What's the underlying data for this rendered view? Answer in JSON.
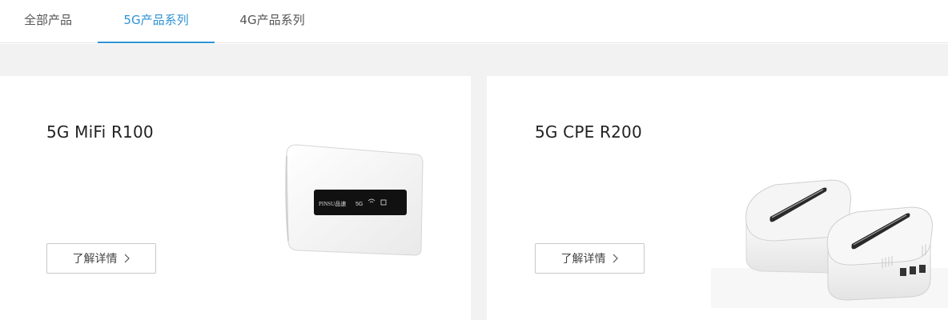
{
  "tabs": [
    {
      "label": "全部产品",
      "active": false
    },
    {
      "label": "5G产品系列",
      "active": true
    },
    {
      "label": "4G产品系列",
      "active": false
    }
  ],
  "accent_color": "#2f93d4",
  "products": [
    {
      "title": "5G MiFi R100",
      "button_label": "了解详情",
      "device_brand_text": "PINSU品速",
      "device_screen_text": "5G",
      "image_icon": "mifi-device-image"
    },
    {
      "title": "5G CPE R200",
      "button_label": "了解详情",
      "image_icon": "cpe-device-image"
    }
  ]
}
